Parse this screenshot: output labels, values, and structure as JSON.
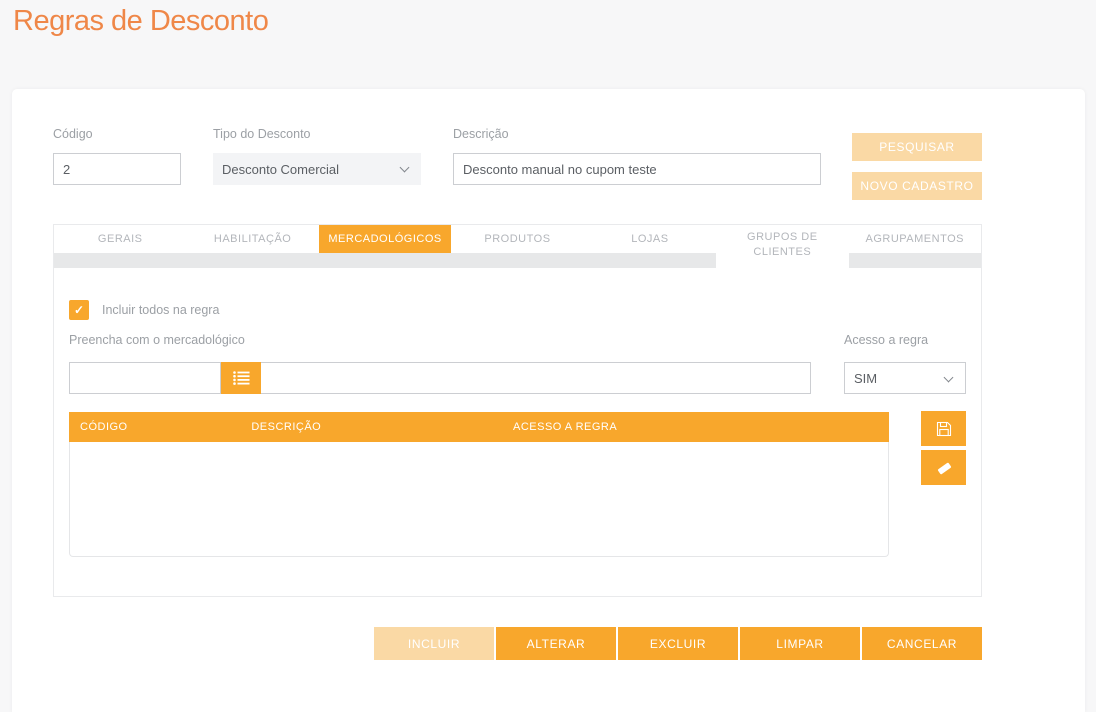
{
  "page": {
    "title": "Regras de Desconto"
  },
  "colors": {
    "accent": "#f8a72c",
    "accent_disabled": "#fad9a5",
    "title_orange": "#ef8748",
    "label_gray": "#9ca0a5"
  },
  "icons": {
    "check": "✓"
  },
  "form": {
    "codigo": {
      "label": "Código",
      "value": "2"
    },
    "tipo": {
      "label": "Tipo do Desconto",
      "value": "Desconto Comercial"
    },
    "descricao": {
      "label": "Descrição",
      "value": "Desconto manual no cupom teste"
    },
    "pesquisar_label": "PESQUISAR",
    "novo_cadastro_label": "NOVO CADASTRO"
  },
  "tabs": [
    {
      "label": "GERAIS",
      "active": false
    },
    {
      "label": "HABILITAÇÃO",
      "active": false
    },
    {
      "label": "MERCADOLÓGICOS",
      "active": true
    },
    {
      "label": "PRODUTOS",
      "active": false
    },
    {
      "label": "LOJAS",
      "active": false
    },
    {
      "label": "GRUPOS DE CLIENTES",
      "active": false
    },
    {
      "label": "AGRUPAMENTOS",
      "active": false
    }
  ],
  "panel": {
    "include_all": {
      "label": "Incluir todos na regra",
      "checked": true
    },
    "fill_label": "Preencha com o mercadológico",
    "lookup": {
      "code_value": "",
      "desc_value": ""
    },
    "access": {
      "label": "Acesso a regra",
      "value": "SIM"
    },
    "table": {
      "columns": [
        "CÓDIGO",
        "DESCRIÇÃO",
        "ACESSO A REGRA"
      ],
      "rows": []
    }
  },
  "actions": [
    {
      "label": "INCLUIR",
      "disabled": true
    },
    {
      "label": "ALTERAR",
      "disabled": false
    },
    {
      "label": "EXCLUIR",
      "disabled": false
    },
    {
      "label": "LIMPAR",
      "disabled": false
    },
    {
      "label": "CANCELAR",
      "disabled": false
    }
  ]
}
